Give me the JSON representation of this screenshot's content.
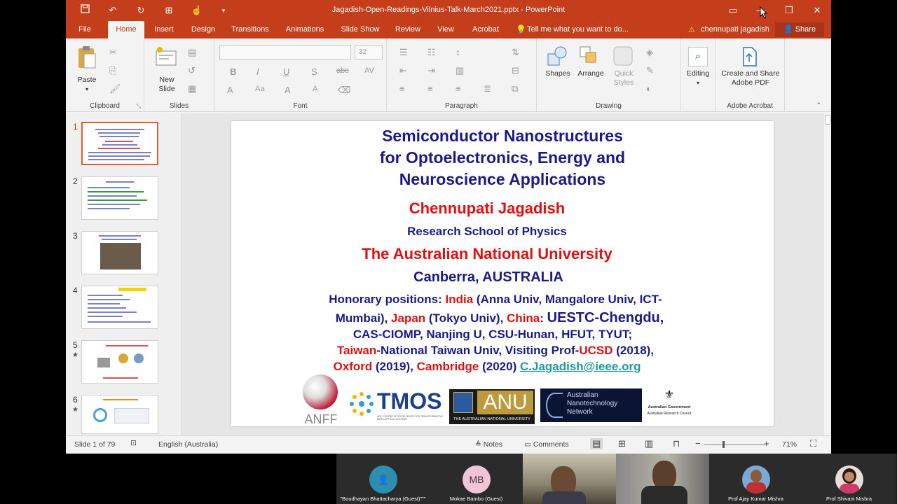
{
  "window": {
    "title": "Jagadish-Open-Readings-Vilnius-Talk-March2021.pptx - PowerPoint"
  },
  "tabs": [
    "File",
    "Home",
    "Insert",
    "Design",
    "Transitions",
    "Animations",
    "Slide Show",
    "Review",
    "View",
    "Acrobat"
  ],
  "active_tab": "Home",
  "tell_me": "Tell me what you want to do...",
  "user_name": "chennupati jagadish",
  "share_label": "Share",
  "ribbon": {
    "clipboard": {
      "paste": "Paste",
      "label": "Clipboard"
    },
    "slides": {
      "new_slide": "New",
      "new_slide2": "Slide",
      "label": "Slides"
    },
    "font": {
      "size": "32",
      "label": "Font"
    },
    "paragraph": {
      "label": "Paragraph"
    },
    "drawing": {
      "shapes": "Shapes",
      "arrange": "Arrange",
      "quick": "Quick",
      "styles": "Styles",
      "label": "Drawing"
    },
    "editing": {
      "label": "Editing"
    },
    "acrobat": {
      "create": "Create and Share",
      "pdf": "Adobe PDF",
      "label": "Adobe Acrobat"
    }
  },
  "thumbnails": [
    "1",
    "2",
    "3",
    "4",
    "5",
    "6"
  ],
  "slide": {
    "title1": "Semiconductor Nanostructures",
    "title2": "for Optoelectronics, Energy and",
    "title3": "Neuroscience Applications",
    "author": "Chennupati Jagadish",
    "school": "Research School of Physics",
    "university": "The Australian National University",
    "city": "Canberra, AUSTRALIA",
    "h1a": "Honorary positions: ",
    "h1b": "India",
    "h1c": " (Anna Univ, Mangalore Univ, ICT-",
    "h2a": "Mumbai), ",
    "h2b": "Japan",
    "h2c": " (Tokyo Univ), ",
    "h2d": "China",
    "h2e": ": ",
    "h2f": "UESTC-Chengdu,",
    "h3": "CAS-CIOMP, Nanjing U, CSU-Hunan, HFUT, TYUT;",
    "h4a": "Taiwan",
    "h4b": "-National Taiwan Univ, Visiting Prof-",
    "h4c": "UCSD",
    "h4d": " (2018),",
    "h5a": "Oxford",
    "h5b": " (2019), ",
    "h5c": "Cambridge",
    "h5d": " (2020) ",
    "email": "C.Jagadish@ieee.org",
    "logos": {
      "anff": "ANFF",
      "tmos": "TMOS",
      "tmos_sub": "ARC CENTRE OF EXCELLENCE FOR TRANSFORMATIVE META-OPTICAL SYSTEMS",
      "anu": "ANU",
      "anu_sub": "THE AUSTRALIAN NATIONAL UNIVERSITY",
      "ann1": "Australian",
      "ann2": "Nanotechnology",
      "ann3": "Network",
      "arc1": "Australian Government",
      "arc2": "Australian Research Council"
    }
  },
  "status": {
    "slide_count": "Slide 1 of 79",
    "language": "English (Australia)",
    "notes": "Notes",
    "comments": "Comments",
    "zoom": "71%"
  },
  "participants": [
    {
      "name": "\"Boudhayan Bhattacharya (Guest)\"\"\"",
      "initials": "",
      "type": "icon"
    },
    {
      "name": "Mokae Bambo (Guest)",
      "initials": "MB",
      "type": "initials"
    },
    {
      "name": "",
      "initials": "",
      "type": "video"
    },
    {
      "name": "",
      "initials": "",
      "type": "video"
    },
    {
      "name": "Prof Ajay Kumar Mishra",
      "initials": "",
      "type": "photo"
    },
    {
      "name": "Prof Shivani Mishra",
      "initials": "",
      "type": "photo"
    }
  ],
  "colors": {
    "brand": "#c43e1c",
    "navy": "#1a1a8a",
    "red": "#e01010",
    "link": "#1e9a9a"
  }
}
